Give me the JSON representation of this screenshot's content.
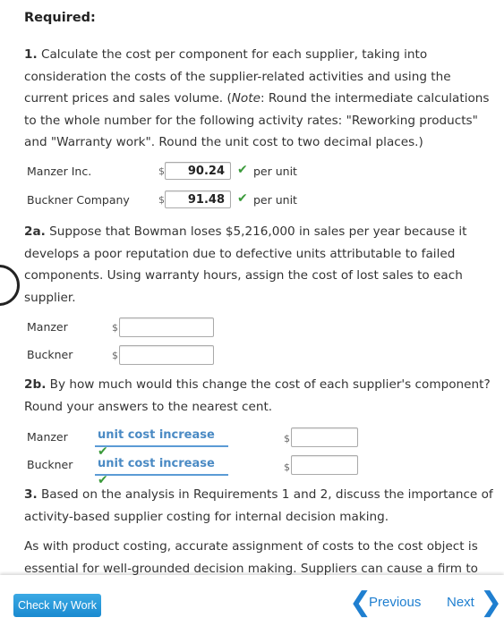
{
  "heading": "Required:",
  "q1": {
    "num": "1.",
    "text_a": " Calculate the cost per component for each supplier, taking into consideration the costs of the supplier-related activities and using the current prices and sales volume. (",
    "note": "Note",
    "text_b": ": Round the intermediate calculations to the whole number for the following activity rates: \"Reworking products\" and \"Warranty work\". Round the unit cost to two decimal places.)",
    "rows": [
      {
        "label": "Manzer Inc.",
        "currency": "$",
        "value": "90.24",
        "unit": "per unit"
      },
      {
        "label": "Buckner Company",
        "currency": "$",
        "value": "91.48",
        "unit": "per unit"
      }
    ]
  },
  "q2a": {
    "num": "2a.",
    "text": " Suppose that Bowman loses $5,216,000 in sales per year because it develops a poor reputation due to defective units attributable to failed components. Using warranty hours, assign the cost of lost sales to each supplier.",
    "rows": [
      {
        "label": "Manzer",
        "currency": "$",
        "value": ""
      },
      {
        "label": "Buckner",
        "currency": "$",
        "value": ""
      }
    ]
  },
  "q2b": {
    "num": "2b.",
    "text": " By how much would this change the cost of each supplier's component? Round your answers to the nearest cent.",
    "rows": [
      {
        "label": "Manzer",
        "select": "unit cost increase",
        "currency": "$",
        "value": ""
      },
      {
        "label": "Buckner",
        "select": "unit cost increase",
        "currency": "$",
        "value": ""
      }
    ]
  },
  "q3": {
    "num": "3.",
    "text": " Based on the analysis in Requirements 1 and 2, discuss the importance of activity-based supplier costing for internal decision making.",
    "answer": "As with product costing, accurate assignment of costs to the cost object is essential for well-grounded decision making. Suppliers can cause a firm to"
  },
  "footer": {
    "check": "Check My Work",
    "previous": "Previous",
    "next": "Next"
  },
  "colors": {
    "accent": "#1f7fd0",
    "check": "#3a9a3a",
    "select_underline": "#5b9bd5"
  }
}
